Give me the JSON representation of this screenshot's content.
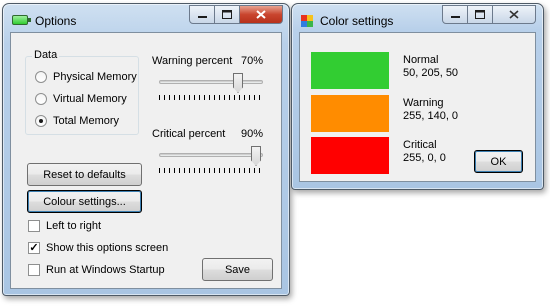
{
  "options_window": {
    "title": "Options",
    "data_group": {
      "legend": "Data",
      "radios": [
        {
          "label": "Physical Memory",
          "checked": false
        },
        {
          "label": "Virtual Memory",
          "checked": false
        },
        {
          "label": "Total Memory",
          "checked": true
        }
      ]
    },
    "warning": {
      "label": "Warning percent",
      "value_text": "70%",
      "value": 70
    },
    "critical": {
      "label": "Critical percent",
      "value_text": "90%",
      "value": 90
    },
    "buttons": {
      "reset": "Reset to defaults",
      "colour_settings": "Colour settings...",
      "save": "Save"
    },
    "checkboxes": [
      {
        "label": "Left to right",
        "checked": false
      },
      {
        "label": "Show this options screen",
        "checked": true
      },
      {
        "label": "Run at Windows Startup",
        "checked": false
      }
    ]
  },
  "color_window": {
    "title": "Color settings",
    "entries": [
      {
        "name": "Normal",
        "rgb": "50, 205, 50",
        "color": "#32cd32"
      },
      {
        "name": "Warning",
        "rgb": "255, 140, 0",
        "color": "#ff8c00"
      },
      {
        "name": "Critical",
        "rgb": "255, 0, 0",
        "color": "#ff0000"
      }
    ],
    "ok_label": "OK"
  },
  "icons": {
    "options_window": "battery-icon",
    "color_window": "color-palette-icon",
    "caption_buttons": [
      "minimize-icon",
      "maximize-icon",
      "close-icon"
    ]
  },
  "colors": {
    "title_bar": "#b8d0ea",
    "client_background": "#f0f0f0",
    "close_button": "#c9452e"
  }
}
